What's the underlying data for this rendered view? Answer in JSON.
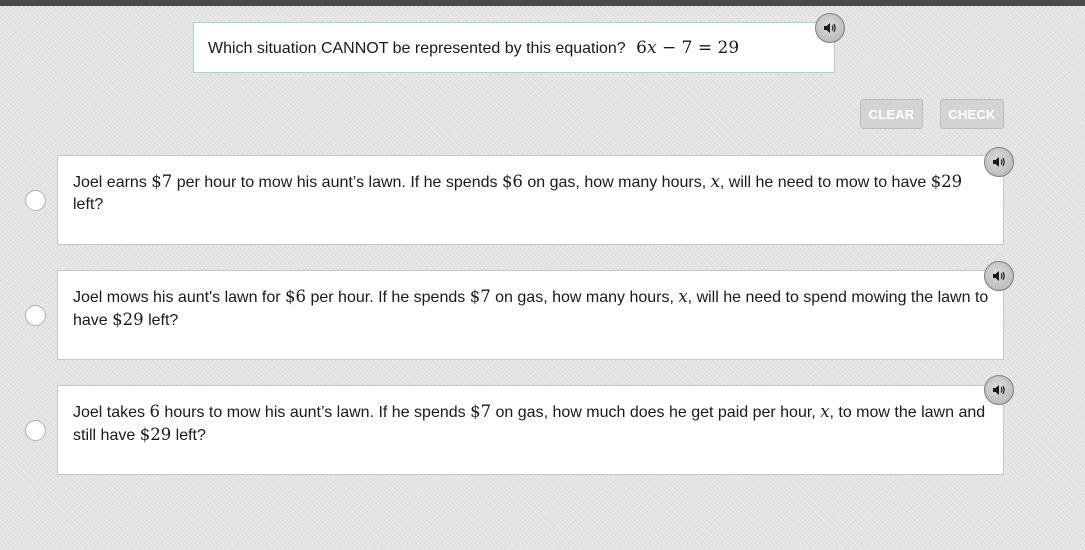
{
  "question": {
    "prompt": "Which situation CANNOT be represented by this equation?",
    "equation": {
      "coef": "6",
      "var": "x",
      "minus": "−",
      "seven": "7",
      "eq": "=",
      "rhs": "29"
    },
    "audio_icon": "speaker-icon"
  },
  "buttons": {
    "clear_label": "CLEAR",
    "check_label": "CHECK"
  },
  "options": [
    {
      "t1": "Joel earns ",
      "m1": "$7",
      "t2": " per hour to mow his aunt’s lawn. If he spends ",
      "m2": "$6",
      "t3": " on gas, how many hours, ",
      "m3": "x",
      "t4": ", will he need to mow to have ",
      "m4": "$29",
      "t5": " left?"
    },
    {
      "t1": "Joel mows his aunt's lawn for ",
      "m1": "$6",
      "t2": " per hour. If he spends ",
      "m2": "$7",
      "t3": " on gas, how many hours, ",
      "m3": "x",
      "t4": ", will he need to spend mowing the lawn to have ",
      "m4": "$29",
      "t5": " left?"
    },
    {
      "t1": "Joel takes ",
      "m1": "6",
      "t2": " hours to mow his aunt’s lawn. If he spends ",
      "m2": "$7",
      "t3": " on gas, how much does he get paid per hour, ",
      "m3": "x",
      "t4": ", to mow the lawn and still have ",
      "m4": "$29",
      "t5": " left?"
    }
  ],
  "colors": {
    "background": "#e3e3e3",
    "question_border": "#9fd4e6",
    "button_disabled": "#d4d4d4"
  }
}
